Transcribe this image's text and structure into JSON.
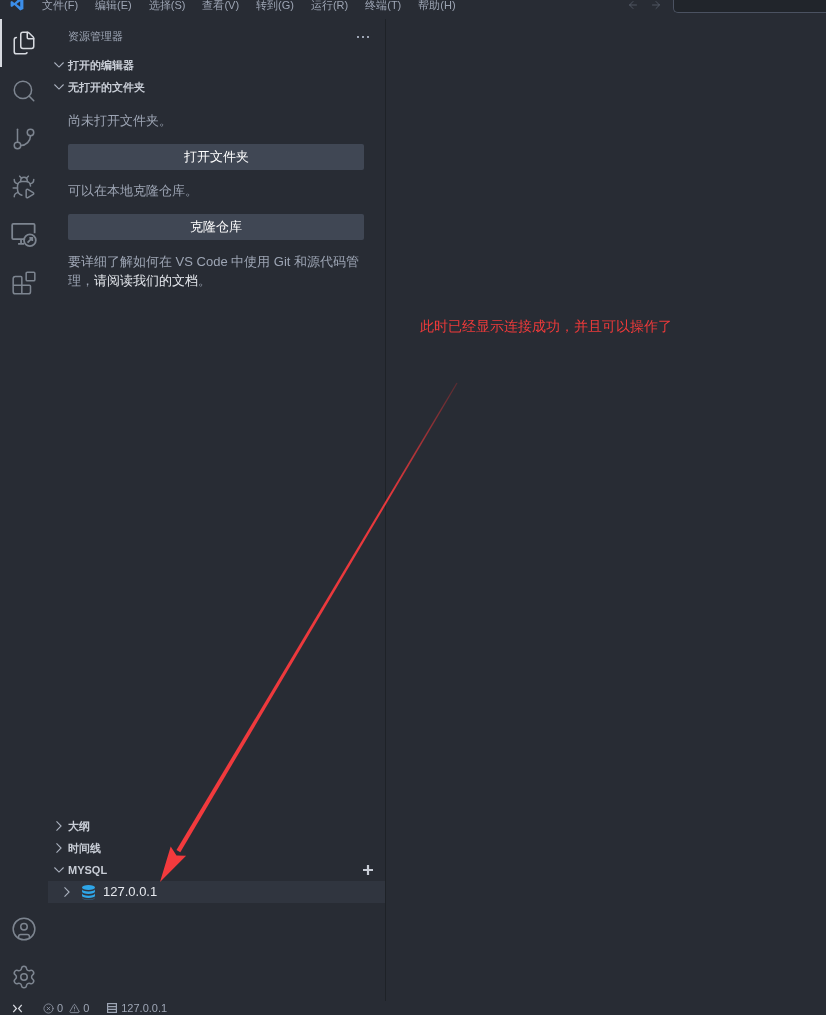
{
  "title_bar": {
    "menus": [
      "文件(F)",
      "编辑(E)",
      "选择(S)",
      "查看(V)",
      "转到(G)",
      "运行(R)",
      "终端(T)",
      "帮助(H)"
    ]
  },
  "activity_bar": {
    "items": [
      {
        "selected": true
      },
      {
        "selected": false
      },
      {
        "selected": false
      },
      {
        "selected": false
      },
      {
        "selected": false
      },
      {
        "selected": false
      }
    ]
  },
  "sidebar": {
    "title": "资源管理器",
    "sections": [
      {
        "label": "打开的编辑器",
        "expanded": true
      },
      {
        "label": "无打开的文件夹",
        "expanded": true,
        "welcome": [
          {
            "kind": "text",
            "text": "尚未打开文件夹。"
          },
          {
            "kind": "button",
            "label": "打开文件夹"
          },
          {
            "kind": "text",
            "text": "可以在本地克隆仓库。"
          },
          {
            "kind": "button",
            "label": "克隆仓库"
          },
          {
            "kind": "paragraph",
            "text": "要详细了解如何在 VS Code 中使用 Git 和源代码管理，",
            "link": "请阅读我们的文档",
            "after": "。"
          }
        ]
      }
    ],
    "bottom_sections": [
      {
        "label": "大纲",
        "expanded": false
      },
      {
        "label": "时间线",
        "expanded": false
      },
      {
        "label": "MYSQL",
        "expanded": true,
        "items": [
          {
            "label": "127.0.0.1",
            "expanded": false,
            "selected": true
          }
        ]
      }
    ]
  },
  "editor": {
    "annotation": "此时已经显示连接成功，并且可以操作了"
  },
  "status_bar": {
    "errors": "0",
    "warnings": "0",
    "connection": "127.0.0.1"
  }
}
